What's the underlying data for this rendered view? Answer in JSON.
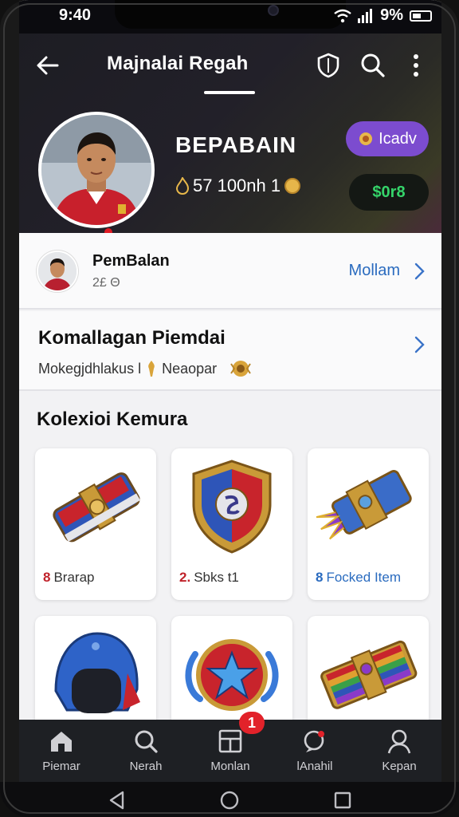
{
  "status_bar": {
    "time": "9:40",
    "battery": "9%"
  },
  "header": {
    "title": "Majnalai Regah",
    "icons": [
      "back-arrow-icon",
      "shield-icon",
      "search-icon",
      "more-vertical-icon"
    ]
  },
  "profile": {
    "name": "BEPABAIN",
    "stat": "57 100nh 1",
    "badge_purple": "Icadv",
    "badge_dark": "$0r8"
  },
  "user_row": {
    "name": "PemBalan",
    "sub": "2£ Θ",
    "link": "Mollam"
  },
  "recommend": {
    "title": "Komallagan Piemdai",
    "sub_left": "Mokegjdhlakus l",
    "sub_right": "Neaopar"
  },
  "collection": {
    "title": "Kolexioi Kemura",
    "items": [
      {
        "num": "8",
        "label": "Brarap",
        "num_color": "#c0222a",
        "label_color": "#333"
      },
      {
        "num": "2.",
        "label": "Sbks t1",
        "num_color": "#c0222a",
        "label_color": "#333"
      },
      {
        "num": "8",
        "label": "Focked Item",
        "num_color": "#2a6bbf",
        "label_color": "#2a6bbf"
      },
      {
        "num": "",
        "label": "",
        "num_color": "#333",
        "label_color": "#333"
      },
      {
        "num": "",
        "label": "",
        "num_color": "#333",
        "label_color": "#333"
      },
      {
        "num": "",
        "label": "",
        "num_color": "#333",
        "label_color": "#333"
      }
    ]
  },
  "bottom_nav": {
    "items": [
      {
        "label": "Piemar",
        "icon": "home-icon"
      },
      {
        "label": "Nerah",
        "icon": "search-icon"
      },
      {
        "label": "Monlan",
        "icon": "grid-icon",
        "badge": "1"
      },
      {
        "label": "lAnahil",
        "icon": "chat-icon"
      },
      {
        "label": "Kepan",
        "icon": "profile-icon"
      }
    ]
  },
  "colors": {
    "accent_purple": "#7c4ccf",
    "accent_green": "#35d46a",
    "link_blue": "#2a6bbf",
    "badge_red": "#e2222a"
  }
}
